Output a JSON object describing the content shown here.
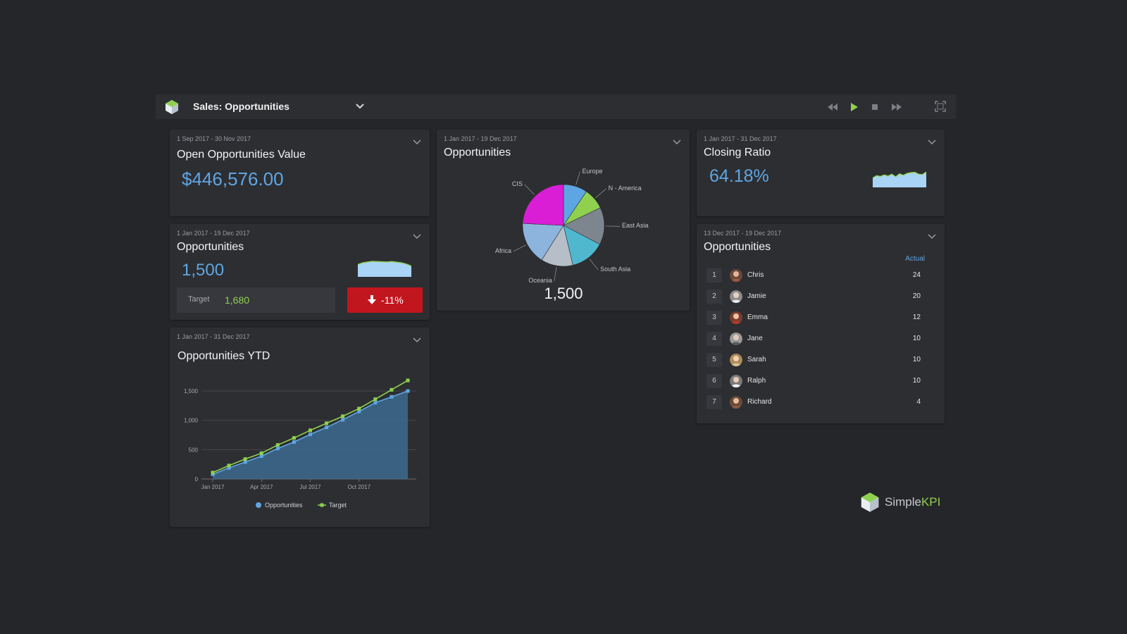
{
  "toolbar": {
    "title": "Sales: Opportunities"
  },
  "widgets": {
    "open_value": {
      "date": "1 Sep 2017 - 30 Nov 2017",
      "title": "Open Opportunities Value",
      "value": "$446,576.00"
    },
    "opportunities_target": {
      "date": "1 Jan 2017 - 19 Dec 2017",
      "title": "Opportunities",
      "value": "1,500",
      "target_label": "Target",
      "target_value": "1,680",
      "delta": "-11%"
    },
    "opportunities_ytd": {
      "date": "1 Jan 2017 - 31 Dec 2017",
      "title": "Opportunities YTD"
    },
    "opportunities_pie": {
      "date": "1 Jan 2017 - 19 Dec 2017",
      "title": "Opportunities",
      "total": "1,500"
    },
    "closing_ratio": {
      "date": "1 Jan 2017 - 31 Dec 2017",
      "title": "Closing Ratio",
      "value": "64.18%"
    },
    "leaderboard": {
      "date": "13 Dec 2017 - 19 Dec 2017",
      "title": "Opportunities",
      "column_header": "Actual",
      "rows": [
        {
          "rank": "1",
          "name": "Chris",
          "value": "24"
        },
        {
          "rank": "2",
          "name": "Jamie",
          "value": "20"
        },
        {
          "rank": "3",
          "name": "Emma",
          "value": "12"
        },
        {
          "rank": "4",
          "name": "Jane",
          "value": "10"
        },
        {
          "rank": "5",
          "name": "Sarah",
          "value": "10"
        },
        {
          "rank": "6",
          "name": "Ralph",
          "value": "10"
        },
        {
          "rank": "7",
          "name": "Richard",
          "value": "4"
        }
      ]
    }
  },
  "brand": {
    "simple": "Simple",
    "kpi": "KPI"
  },
  "colors": {
    "accent_blue": "#5ea6e3",
    "accent_green": "#8fd14f",
    "negative_red": "#c2161e",
    "panel_bg": "#2d2e32",
    "page_bg": "#252629"
  },
  "chart_data": [
    {
      "type": "pie",
      "categories": [
        "Europe",
        "N - America",
        "East Asia",
        "South Asia",
        "Oceania",
        "Africa",
        "CIS"
      ],
      "values": [
        9,
        8,
        14,
        13,
        12,
        16,
        23
      ],
      "colors": [
        "#5ea6e3",
        "#8fd14f",
        "#7d858e",
        "#4fb8cf",
        "#b6bfc8",
        "#8cb4dd",
        "#d91ed6"
      ],
      "total_label": "1,500"
    },
    {
      "type": "area",
      "x_tick_labels": [
        "Jan 2017",
        "Apr 2017",
        "Jul 2017",
        "Oct 2017"
      ],
      "y_ticks": [
        0,
        500,
        1000,
        1500
      ],
      "y_tick_labels": [
        "0",
        "500",
        "1,000",
        "1,500"
      ],
      "ylim": [
        0,
        1800
      ],
      "series": [
        {
          "name": "Opportunities",
          "color": "#5ea6e3",
          "values": [
            80,
            190,
            290,
            390,
            520,
            630,
            760,
            880,
            1010,
            1150,
            1300,
            1400,
            1500
          ]
        },
        {
          "name": "Target",
          "color": "#8fd14f",
          "values": [
            110,
            230,
            340,
            440,
            580,
            700,
            830,
            950,
            1070,
            1200,
            1360,
            1520,
            1680
          ]
        }
      ],
      "legend_placement": "bottom"
    },
    {
      "type": "area",
      "sparkline": "opportunities",
      "values": [
        60,
        68,
        72,
        75,
        74,
        73,
        72,
        74,
        71,
        68,
        62,
        52
      ]
    },
    {
      "type": "area",
      "sparkline": "closing_ratio",
      "values": [
        50,
        62,
        58,
        66,
        60,
        70,
        56,
        72,
        64,
        74,
        78,
        80,
        70,
        68,
        82
      ]
    }
  ]
}
